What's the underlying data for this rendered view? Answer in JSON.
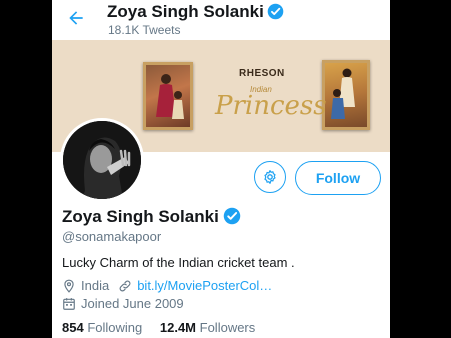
{
  "header": {
    "name": "Zoya Singh Solanki",
    "tweet_count": "18.1K Tweets"
  },
  "banner": {
    "brand": "RHESON",
    "tagline_small": "Indian",
    "tagline_large": "Princess"
  },
  "actions": {
    "follow_label": "Follow"
  },
  "profile": {
    "name": "Zoya Singh Solanki",
    "handle": "@sonamakapoor",
    "bio": "Lucky Charm of the Indian cricket team .",
    "location": "India",
    "website": "bit.ly/MoviePosterCol…",
    "joined": "Joined June 2009"
  },
  "stats": {
    "following_count": "854",
    "following_label": "Following",
    "followers_count": "12.4M",
    "followers_label": "Followers"
  },
  "colors": {
    "accent": "#1da1f2",
    "text": "#14171a",
    "secondary": "#657786"
  },
  "icons": [
    "back-arrow-icon",
    "verified-icon",
    "gear-icon",
    "location-pin-icon",
    "link-icon",
    "calendar-icon"
  ]
}
